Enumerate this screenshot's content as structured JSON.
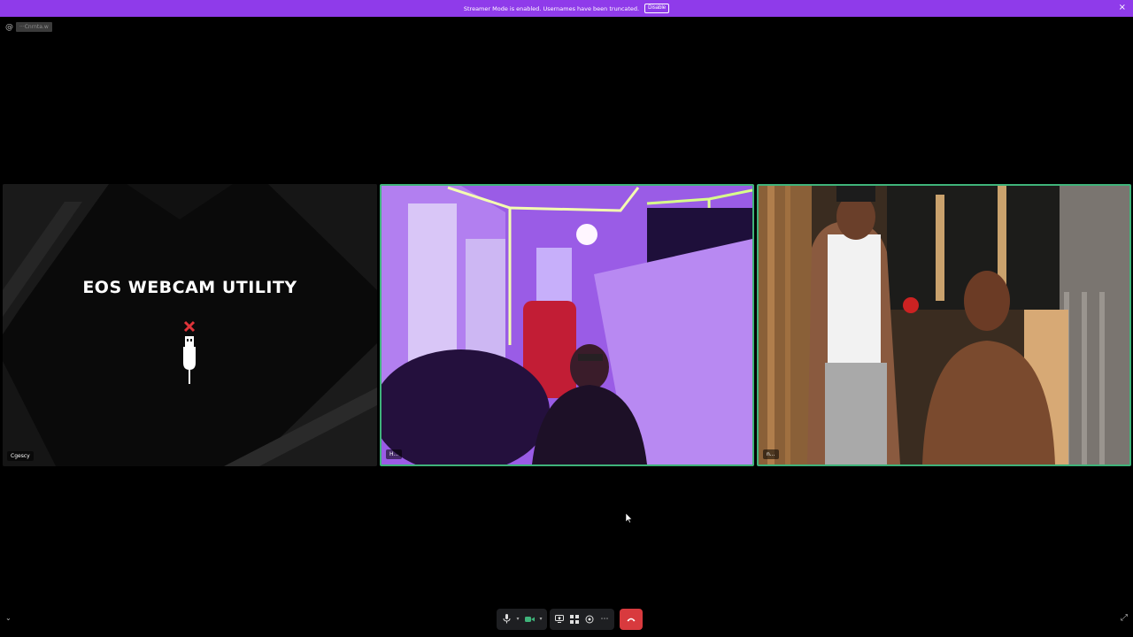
{
  "notice": {
    "text": "Streamer Mode is enabled. Usernames have been truncated.",
    "button_label": "Disable",
    "close_glyph": "×",
    "color": "#8f3bea"
  },
  "channel": {
    "prefix_icon": "at-icon",
    "name": "···Cnrnta.w"
  },
  "tiles": [
    {
      "label": "Cgescy",
      "title": "EOS WEBCAM UTILITY",
      "icon": "usb-disconnected-icon"
    },
    {
      "label": "H...",
      "speaking": true
    },
    {
      "label": "n...",
      "speaking": true
    }
  ],
  "controls": {
    "mic_icon": "microphone-icon",
    "camera_icon": "camera-icon",
    "screenshare_icon": "screen-share-icon",
    "activities_icon": "activities-icon",
    "soundboard_icon": "soundboard-icon",
    "more_icon": "more-icon",
    "end_call_icon": "hang-up-icon",
    "end_call_color": "#d83a3e"
  },
  "accent_speaking": "#3fb37a"
}
